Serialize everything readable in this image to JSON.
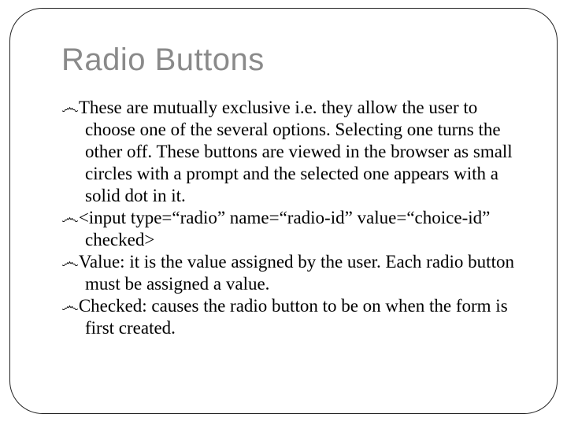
{
  "title": "Radio Buttons",
  "bullet_symbol": "෴",
  "items": [
    "These are mutually exclusive i.e. they allow the user to choose one of the several options. Selecting one turns the other off. These buttons are viewed in the browser as small circles with a prompt and the selected one appears with a solid dot in it.",
    "<input type=“radio” name=“radio-id” value=“choice-id” checked>",
    "Value: it is the value assigned by the user. Each radio button must be assigned a value.",
    "Checked: causes the radio button to be on when the form is first created."
  ]
}
